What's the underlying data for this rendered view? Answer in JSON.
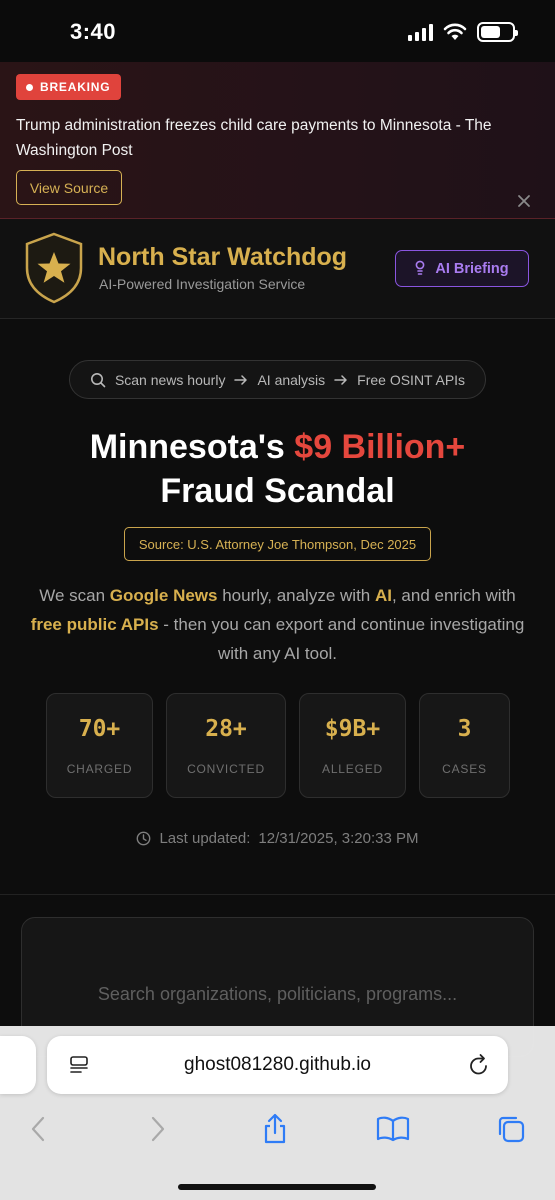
{
  "status_bar": {
    "time": "3:40"
  },
  "banner": {
    "badge": "BREAKING",
    "headline": "Trump administration freezes child care payments to Minnesota - The Washington Post",
    "view_source": "View Source"
  },
  "header": {
    "title": "North Star Watchdog",
    "subtitle": "AI-Powered Investigation Service",
    "ai_button": "AI Briefing"
  },
  "hero": {
    "pipeline": [
      "Scan news hourly",
      "AI analysis",
      "Free OSINT APIs"
    ],
    "title_before": "Minnesota's ",
    "title_highlight": "$9 Billion+",
    "title_after": " Fraud Scandal",
    "source": "Source: U.S. Attorney Joe Thompson, Dec 2025",
    "desc": {
      "p1": "We scan ",
      "b1": "Google News",
      "p2": " hourly, analyze with ",
      "b2": "AI",
      "p3": ", and enrich with ",
      "b3": "free public APIs",
      "p4": " - then you can export and continue investigating with any AI tool."
    },
    "stats": [
      {
        "value": "70+",
        "label": "CHARGED"
      },
      {
        "value": "28+",
        "label": "CONVICTED"
      },
      {
        "value": "$9B+",
        "label": "ALLEGED"
      },
      {
        "value": "3",
        "label": "CASES"
      }
    ],
    "updated_label": "Last updated:",
    "updated_value": "12/31/2025, 3:20:33 PM"
  },
  "search": {
    "placeholder": "Search organizations, politicians, programs..."
  },
  "browser": {
    "url": "ghost081280.github.io"
  },
  "colors": {
    "gold": "#d8b04e",
    "red": "#e5473d",
    "purple": "#8a55e0"
  }
}
